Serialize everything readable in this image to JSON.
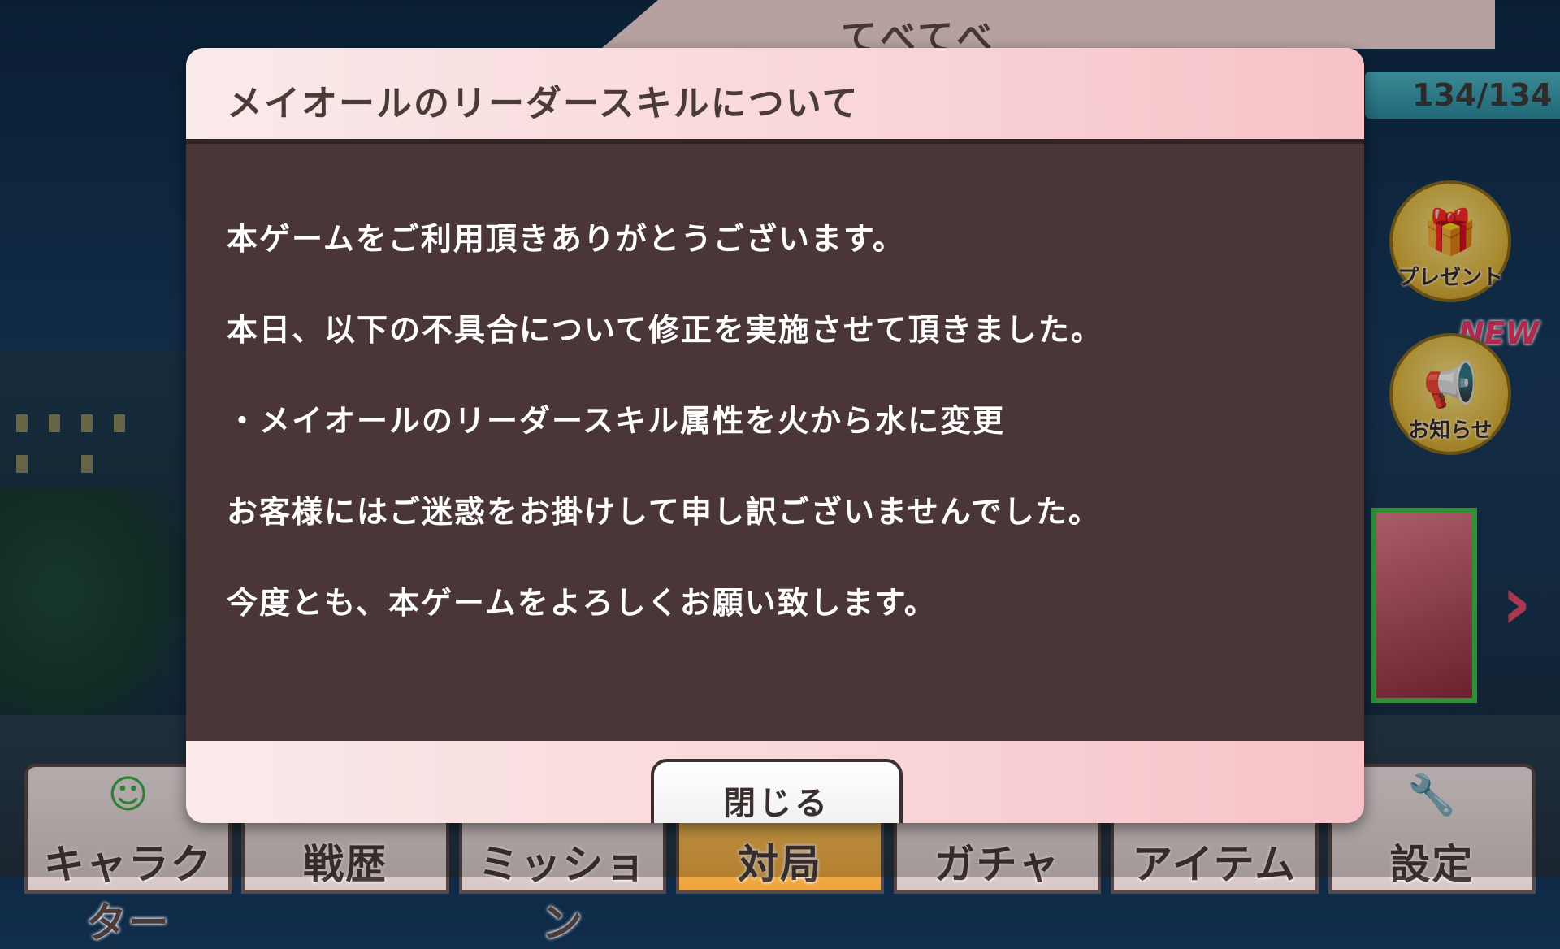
{
  "background": {
    "top_banner": "てべてべ",
    "stamina": "134/134",
    "side_buttons": [
      {
        "label": "プレゼント",
        "icon": "gift-icon"
      },
      {
        "label": "お知らせ",
        "icon": "notice-icon"
      }
    ],
    "new_badge": "NEW",
    "bottom_nav": [
      {
        "label": "キャラクター",
        "icon": "character-icon"
      },
      {
        "label": "戦歴",
        "icon": "history-icon"
      },
      {
        "label": "ミッション",
        "icon": "mission-icon"
      },
      {
        "label": "対局",
        "icon": "match-icon"
      },
      {
        "label": "ガチャ",
        "icon": "gacha-icon"
      },
      {
        "label": "アイテム",
        "icon": "item-icon"
      },
      {
        "label": "設定",
        "icon": "wrench-icon"
      }
    ]
  },
  "dialog": {
    "title": "メイオールのリーダースキルについて",
    "lines": [
      "本ゲームをご利用頂きありがとうございます。",
      "本日、以下の不具合について修正を実施させて頂きました。",
      "・メイオールのリーダースキル属性を火から水に変更",
      "お客様にはご迷惑をお掛けして申し訳ございませんでした。",
      "今度とも、本ゲームをよろしくお願い致します。"
    ],
    "close_label": "閉じる"
  },
  "colors": {
    "dialog_body": "#4a3637",
    "dialog_header": "#f9d5d8",
    "text_light": "#ffffff",
    "text_dark": "#4a3b38"
  }
}
